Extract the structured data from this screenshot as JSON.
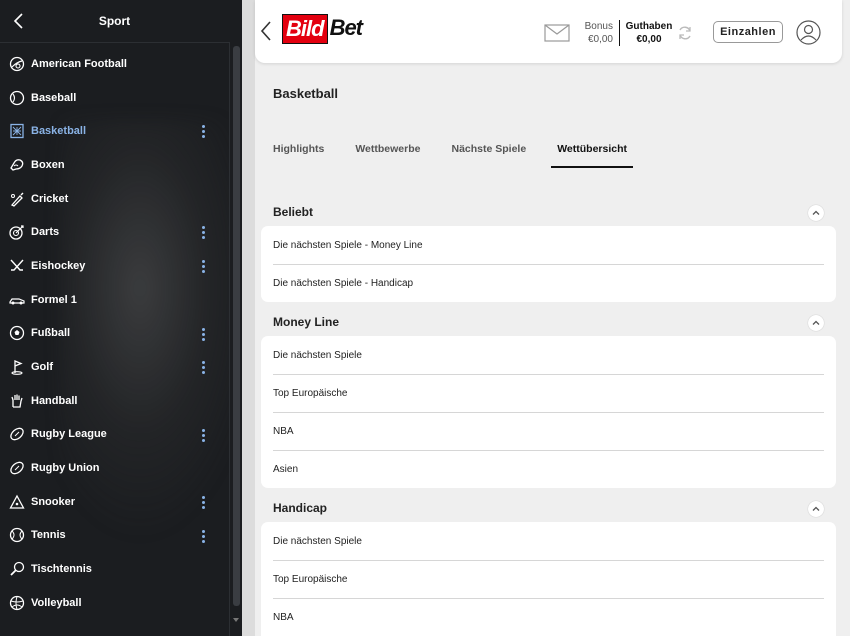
{
  "sidebar": {
    "title": "Sport",
    "items": [
      {
        "label": "American Football",
        "icon": "american-football-icon",
        "more": false
      },
      {
        "label": "Baseball",
        "icon": "baseball-icon",
        "more": false
      },
      {
        "label": "Basketball",
        "icon": "basketball-icon",
        "more": true,
        "active": true
      },
      {
        "label": "Boxen",
        "icon": "boxing-glove-icon",
        "more": false
      },
      {
        "label": "Cricket",
        "icon": "cricket-bat-icon",
        "more": false
      },
      {
        "label": "Darts",
        "icon": "dartboard-icon",
        "more": true
      },
      {
        "label": "Eishockey",
        "icon": "hockey-sticks-icon",
        "more": true
      },
      {
        "label": "Formel 1",
        "icon": "race-car-icon",
        "more": false
      },
      {
        "label": "Fußball",
        "icon": "soccer-ball-icon",
        "more": true
      },
      {
        "label": "Golf",
        "icon": "golf-flag-icon",
        "more": true
      },
      {
        "label": "Handball",
        "icon": "handball-icon",
        "more": false
      },
      {
        "label": "Rugby League",
        "icon": "rugby-ball-icon",
        "more": true
      },
      {
        "label": "Rugby Union",
        "icon": "rugby-ball-icon",
        "more": false
      },
      {
        "label": "Snooker",
        "icon": "snooker-triangle-icon",
        "more": true
      },
      {
        "label": "Tennis",
        "icon": "tennis-ball-icon",
        "more": true
      },
      {
        "label": "Tischtennis",
        "icon": "table-tennis-icon",
        "more": false
      },
      {
        "label": "Volleyball",
        "icon": "volleyball-icon",
        "more": false
      }
    ]
  },
  "header": {
    "logo_left": "Bild",
    "logo_right": "Bet",
    "bonus_label": "Bonus",
    "bonus_value": "€0,00",
    "guthaben_label": "Guthaben",
    "guthaben_value": "€0,00",
    "deposit_label": "Einzahlen"
  },
  "main": {
    "title": "Basketball",
    "tabs": [
      "Highlights",
      "Wettbewerbe",
      "Nächste Spiele",
      "Wettübersicht"
    ],
    "active_tab": 3,
    "sections": [
      {
        "title": "Beliebt",
        "rows": [
          "Die nächsten Spiele - Money Line",
          "Die nächsten Spiele - Handicap"
        ]
      },
      {
        "title": "Money Line",
        "rows": [
          "Die nächsten Spiele",
          "Top Europäische",
          "NBA",
          "Asien"
        ]
      },
      {
        "title": "Handicap",
        "rows": [
          "Die nächsten Spiele",
          "Top Europäische",
          "NBA"
        ]
      }
    ]
  },
  "colors": {
    "accent": "#8ab3e6",
    "brand_red": "#e3000f",
    "sidebar_bg": "#1b1d20",
    "page_bg": "#efefef"
  }
}
